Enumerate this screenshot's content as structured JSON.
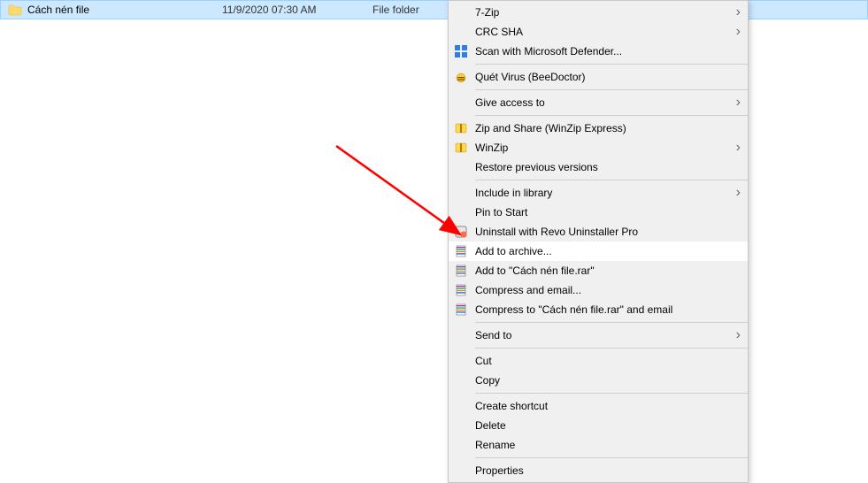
{
  "file_row": {
    "name": "Cách nén file",
    "date": "11/9/2020 07:30 AM",
    "type": "File folder"
  },
  "context_menu": {
    "items": [
      {
        "label": "7-Zip",
        "submenu": true,
        "icon": "none"
      },
      {
        "label": "CRC SHA",
        "submenu": true,
        "icon": "none"
      },
      {
        "label": "Scan with Microsoft Defender...",
        "submenu": false,
        "icon": "defender"
      },
      {
        "separator": true
      },
      {
        "label": "Quét Virus (BeeDoctor)",
        "submenu": false,
        "icon": "bee"
      },
      {
        "separator": true
      },
      {
        "label": "Give access to",
        "submenu": true,
        "icon": "none"
      },
      {
        "separator": true
      },
      {
        "label": "Zip and Share (WinZip Express)",
        "submenu": false,
        "icon": "winzip"
      },
      {
        "label": "WinZip",
        "submenu": true,
        "icon": "winzip"
      },
      {
        "label": "Restore previous versions",
        "submenu": false,
        "icon": "none"
      },
      {
        "separator": true
      },
      {
        "label": "Include in library",
        "submenu": true,
        "icon": "none"
      },
      {
        "label": "Pin to Start",
        "submenu": false,
        "icon": "none"
      },
      {
        "label": "Uninstall with Revo Uninstaller Pro",
        "submenu": false,
        "icon": "revo"
      },
      {
        "label": "Add to archive...",
        "submenu": false,
        "icon": "rar",
        "highlighted": true
      },
      {
        "label": "Add to \"Cách nén file.rar\"",
        "submenu": false,
        "icon": "rar"
      },
      {
        "label": "Compress and email...",
        "submenu": false,
        "icon": "rar"
      },
      {
        "label": "Compress to \"Cách nén file.rar\" and email",
        "submenu": false,
        "icon": "rar"
      },
      {
        "separator": true
      },
      {
        "label": "Send to",
        "submenu": true,
        "icon": "none"
      },
      {
        "separator": true
      },
      {
        "label": "Cut",
        "submenu": false,
        "icon": "none"
      },
      {
        "label": "Copy",
        "submenu": false,
        "icon": "none"
      },
      {
        "separator": true
      },
      {
        "label": "Create shortcut",
        "submenu": false,
        "icon": "none"
      },
      {
        "label": "Delete",
        "submenu": false,
        "icon": "none"
      },
      {
        "label": "Rename",
        "submenu": false,
        "icon": "none"
      },
      {
        "separator": true
      },
      {
        "label": "Properties",
        "submenu": false,
        "icon": "none"
      }
    ]
  }
}
